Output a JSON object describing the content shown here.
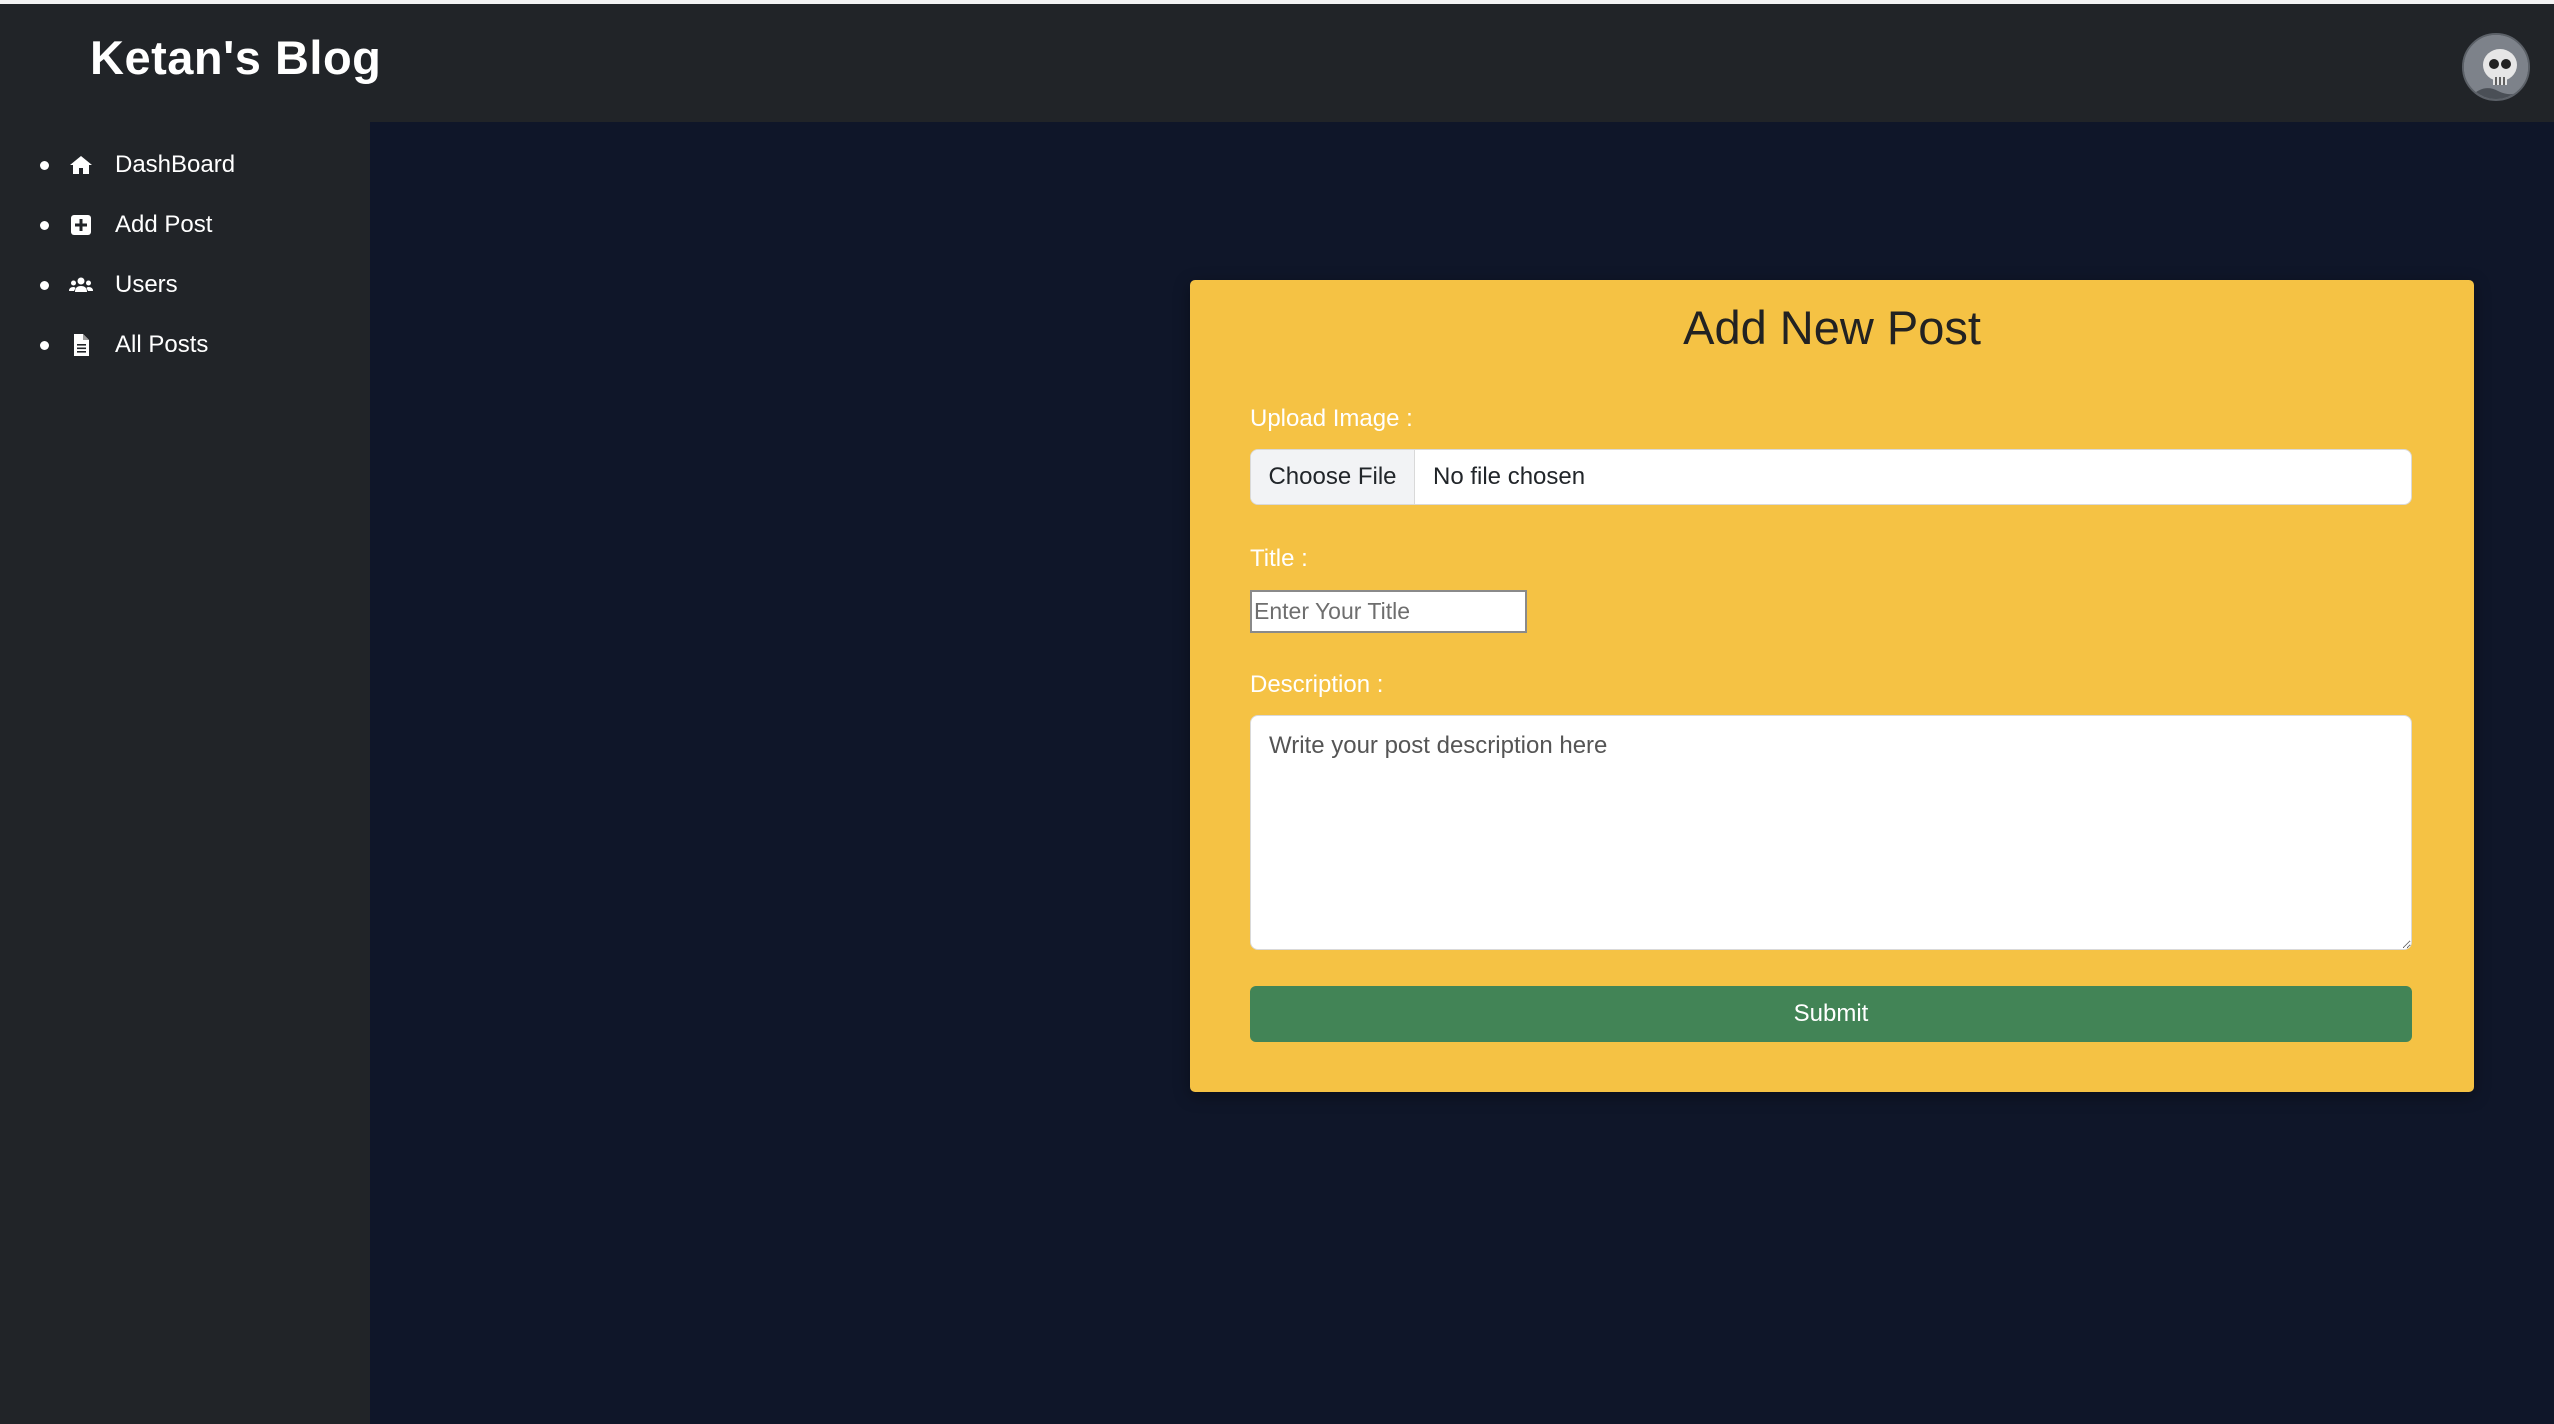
{
  "header": {
    "brand": "Ketan's Blog",
    "avatar_icon": "skull-avatar"
  },
  "sidebar": {
    "items": [
      {
        "label": "DashBoard",
        "icon": "home-icon"
      },
      {
        "label": "Add Post",
        "icon": "plus-square-icon"
      },
      {
        "label": "Users",
        "icon": "users-icon"
      },
      {
        "label": "All Posts",
        "icon": "file-icon"
      }
    ]
  },
  "form": {
    "title": "Add New Post",
    "upload_label": "Upload Image :",
    "choose_file": "Choose File",
    "file_status": "No file chosen",
    "title_label": "Title :",
    "title_placeholder": "Enter Your Title",
    "description_label": "Description :",
    "description_placeholder": "Write your post description here",
    "submit": "Submit"
  },
  "colors": {
    "navbar": "#212428",
    "main_bg": "#0f1629",
    "card": "#f5c244",
    "submit": "#428456"
  }
}
